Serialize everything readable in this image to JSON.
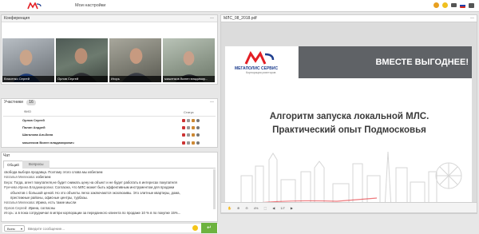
{
  "topbar": {
    "settings_label": "Мои настройки"
  },
  "conference": {
    "title": "Конференция",
    "videos": [
      {
        "name": "Власенко Сергей"
      },
      {
        "name": "Орлов Сергей"
      },
      {
        "name": "Игорь"
      },
      {
        "name": "мишенков Вилен владимир..."
      }
    ]
  },
  "participants": {
    "title": "Участники",
    "count": "16",
    "col_fio": "ФИО",
    "col_status": "Статус",
    "rows": [
      {
        "name": "Орлов Сергей"
      },
      {
        "name": "Палин Андрей"
      },
      {
        "name": "Шагалова Альбина"
      },
      {
        "name": "мишенков Вилен владимирович"
      }
    ]
  },
  "chat": {
    "title": "Чат",
    "tab_general": "Общий",
    "tab_questions": "Вопросы",
    "messages": [
      {
        "text": "свобода выбора продавца. Поэтому этого слова мы избегаем"
      },
      {
        "name": "Наталья Мелехова:",
        "text": "избегаем"
      },
      {
        "name": "Вера:",
        "text": "Тогда, агент покупателя,не будет снижать цену на объект и не будет работать в интересах покупателя"
      },
      {
        "name": "Рунчева Ирина  Владимировна:",
        "text": "Согласна, что МЛС может быть эффективным инструментом для продажи"
      },
      {
        "text": "объектов с большой ценой. Но это объекты легко заключаются эксклюзивы. Это элитные квартиры, дома,"
      },
      {
        "text": "престижные районы, офисные центры, турбазы."
      },
      {
        "name": "Наталья Мелехова:",
        "text": "Ирина,  есть  такие мысли"
      },
      {
        "name": "Орлов Сергей:",
        "text": "Ирина, согласны"
      },
      {
        "name": "Игорь:",
        "text": "а в пока сотрудничал в мгпри корпорации за переданного клиента по продаже 10 % в по покупке 15%..."
      }
    ],
    "recipient": "Всем",
    "input_placeholder": "Введите сообщение..."
  },
  "pdf": {
    "filename": "МЛС_08_2018.pdf",
    "page_info": "1/7",
    "zoom": "4%",
    "slide": {
      "brand_name": "МЕГАПОЛИС СЕРВИС",
      "brand_sub": "Корпорация риэлторов",
      "slogan": "ВМЕСТЕ ВЫГОДНЕЕ!",
      "title_line1": "Алгоритм запуска локальной МЛС.",
      "title_line2": "Практический опыт Подмосковья"
    }
  },
  "colors": {
    "brand_red": "#e31e24",
    "send_green": "#6db33f",
    "bg": "#e7e7e7"
  }
}
